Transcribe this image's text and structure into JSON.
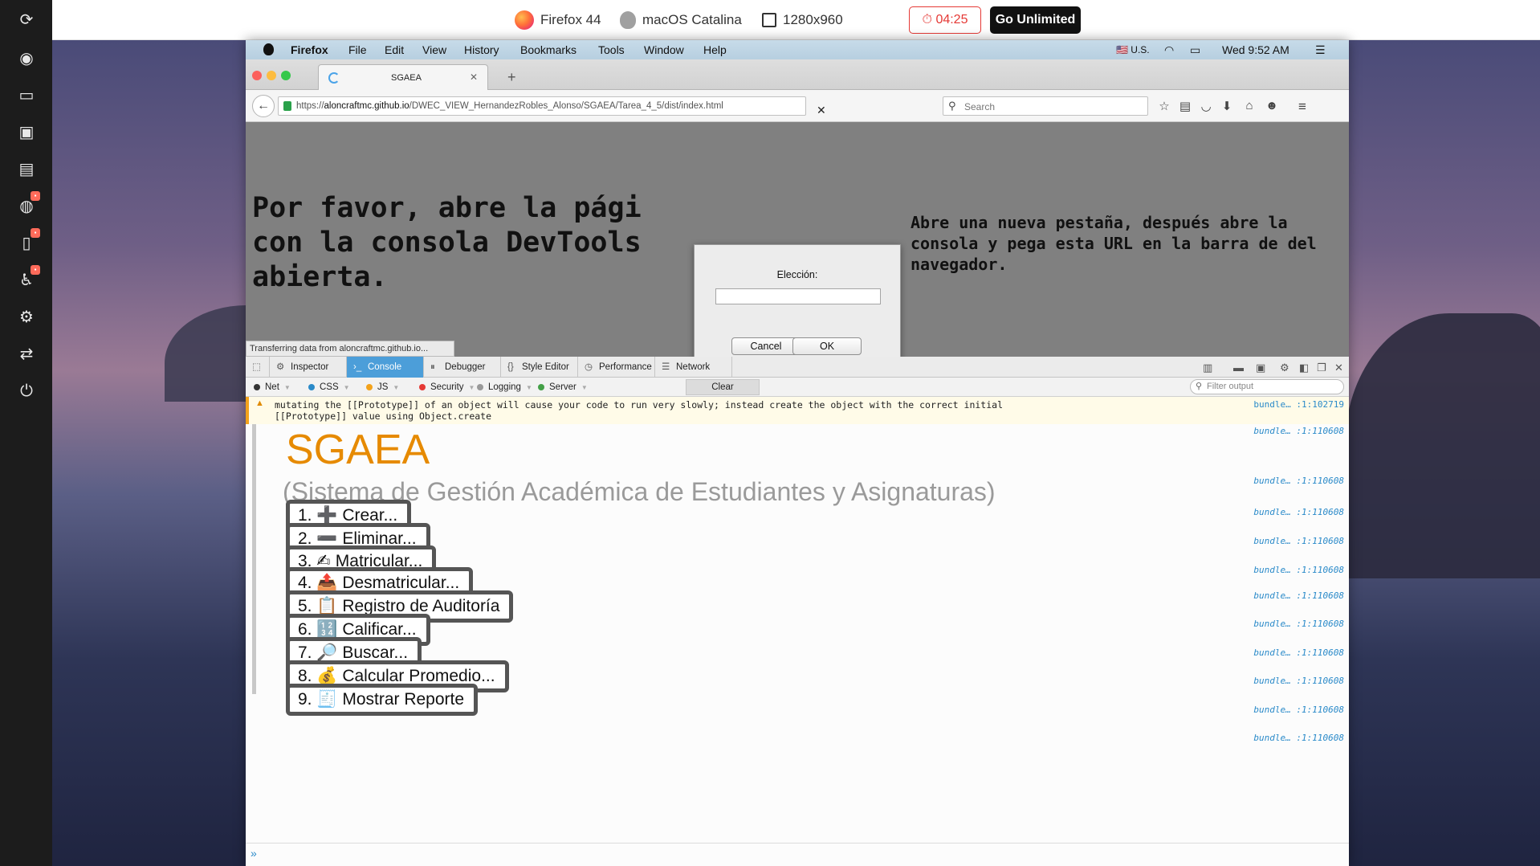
{
  "top_banner": {
    "browser": "Firefox 44",
    "os": "macOS Catalina",
    "resolution": "1280x960",
    "timer": "04:25",
    "cta": "Go Unlimited"
  },
  "mac_menubar": {
    "items": [
      "Firefox",
      "File",
      "Edit",
      "View",
      "History",
      "Bookmarks",
      "Tools",
      "Window",
      "Help"
    ],
    "input_source": "U.S.",
    "clock": "Wed 9:52 AM"
  },
  "tab": {
    "title": "SGAEA"
  },
  "navbar": {
    "url_prefix": "https://",
    "url_host": "aloncraftmc.github.io",
    "url_path": "/DWEC_VIEW_HernandezRobles_Alonso/SGAEA/Tarea_4_5/dist/index.html",
    "search_placeholder": "Search"
  },
  "page": {
    "left_message": "Por favor, abre la pági con la consola DevTools abierta.",
    "right_message": "Abre una nueva pestaña, después abre la consola y pega esta URL en la barra de del navegador.",
    "status": "Transferring data from aloncraftmc.github.io..."
  },
  "dialog": {
    "label": "Elección:",
    "cancel": "Cancel",
    "ok": "OK"
  },
  "devtools": {
    "tabs": [
      "Inspector",
      "Console",
      "Debugger",
      "Style Editor",
      "Performance",
      "Network"
    ],
    "active_tab": "Console",
    "filters": [
      {
        "label": "Net",
        "color": "#333333"
      },
      {
        "label": "CSS",
        "color": "#2a8ac9"
      },
      {
        "label": "JS",
        "color": "#f3a21b"
      },
      {
        "label": "Security",
        "color": "#e53935"
      },
      {
        "label": "Logging",
        "color": "#999999"
      },
      {
        "label": "Server",
        "color": "#43a047"
      }
    ],
    "clear": "Clear",
    "filter_placeholder": "Filter output",
    "warning": {
      "text": "mutating the [[Prototype]] of an object will cause your code to run very slowly; instead create the object with the correct initial [[Prototype]] value using Object.create",
      "source": "bundle… :1:102719"
    },
    "log_source": "bundle… :1:110608",
    "sgaea_title": "SGAEA",
    "sgaea_subtitle": "(Sistema de Gestión Académica de Estudiantes y Asignaturas)",
    "menu": [
      "1. ➕ Crear...",
      "2. ➖ Eliminar...",
      "3. ✍ Matricular...",
      "4. 📤 Desmatricular...",
      "5. 📋 Registro de Auditoría",
      "6. 🔢 Calificar...",
      "7. 🔎 Buscar...",
      "8. 💰 Calcular Promedio...",
      "9. 🧾 Mostrar Reporte"
    ]
  }
}
